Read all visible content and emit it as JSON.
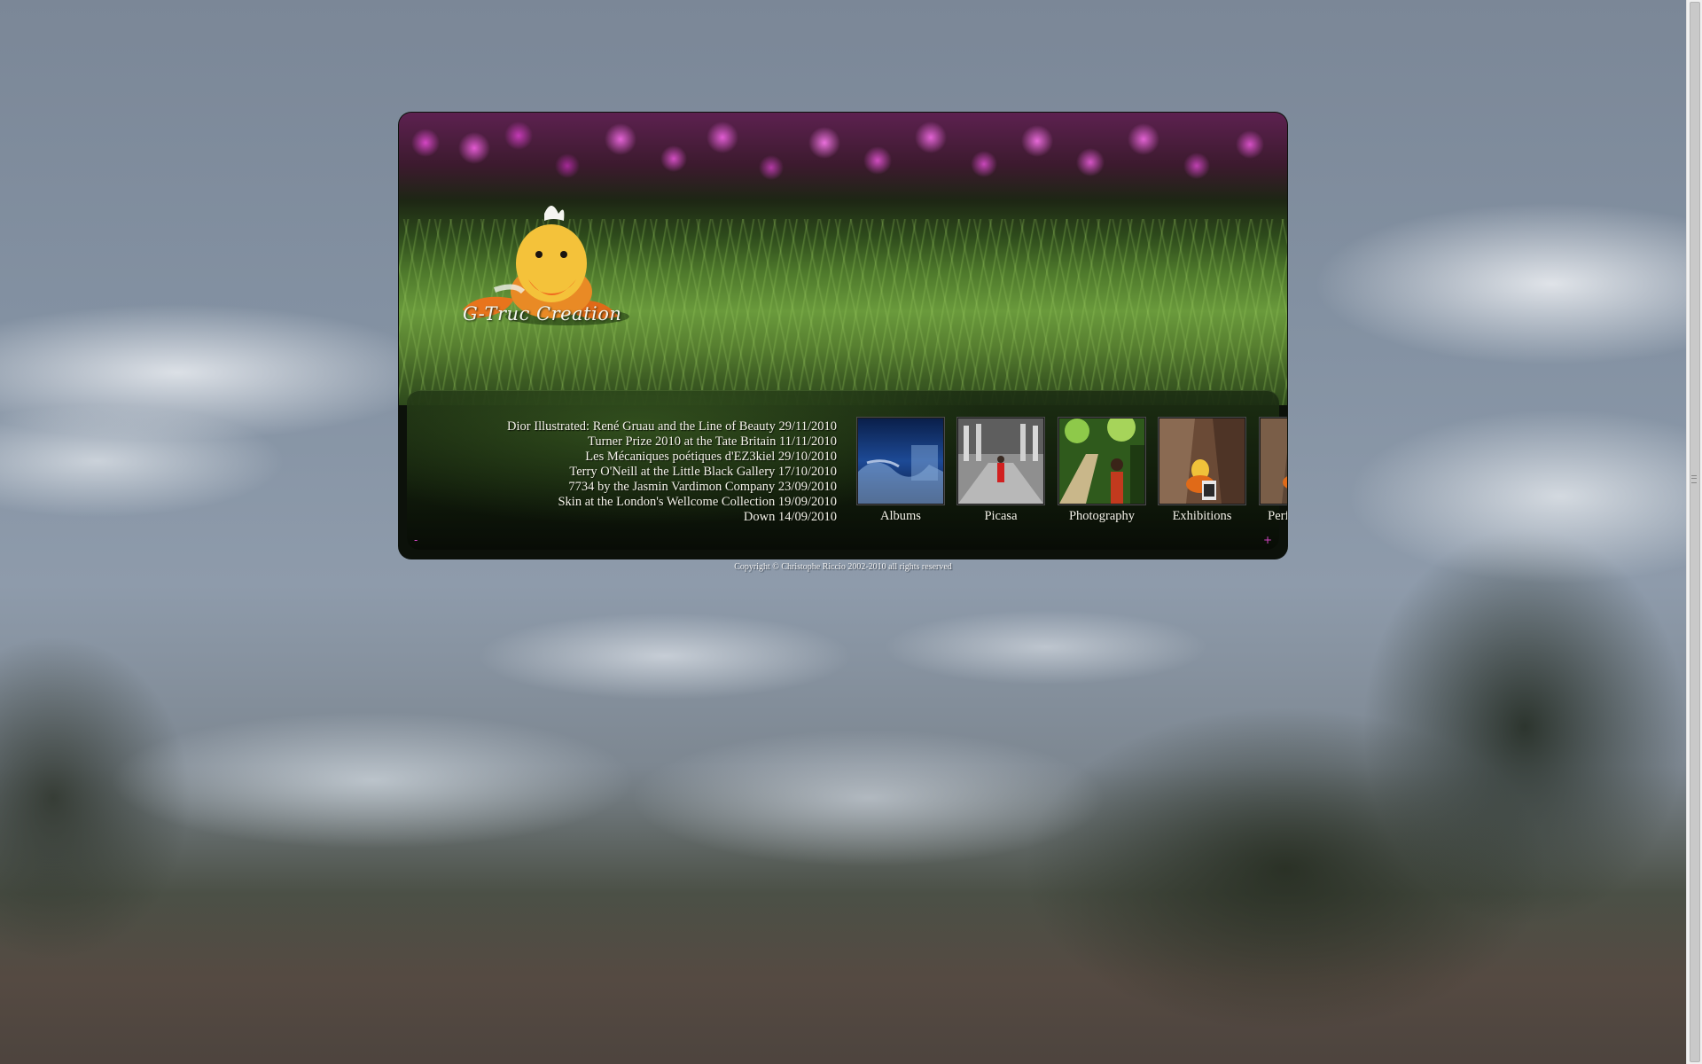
{
  "site": {
    "title": "G-Truc Creation",
    "copyright": "Copyright © Christophe Riccio 2002-2010 all rights reserved"
  },
  "news": [
    "Dior Illustrated: René Gruau and the Line of Beauty 29/11/2010",
    "Turner Prize 2010 at the Tate Britain 11/11/2010",
    "Les Mécaniques poétiques d'EZ3kiel 29/10/2010",
    "Terry O'Neill at the Little Black Gallery 17/10/2010",
    "7734 by the Jasmin Vardimon Company 23/09/2010",
    "Skin at the London's Wellcome Collection 19/09/2010",
    "Down 14/09/2010"
  ],
  "gallery": [
    {
      "label": "Albums"
    },
    {
      "label": "Picasa"
    },
    {
      "label": "Photography"
    },
    {
      "label": "Exhibitions"
    },
    {
      "label": "Performances"
    }
  ],
  "nav": {
    "prev": "-",
    "next": "+"
  },
  "colors": {
    "accent": "#d446c4",
    "panel": "#18240f",
    "text": "#f3f1e8"
  }
}
